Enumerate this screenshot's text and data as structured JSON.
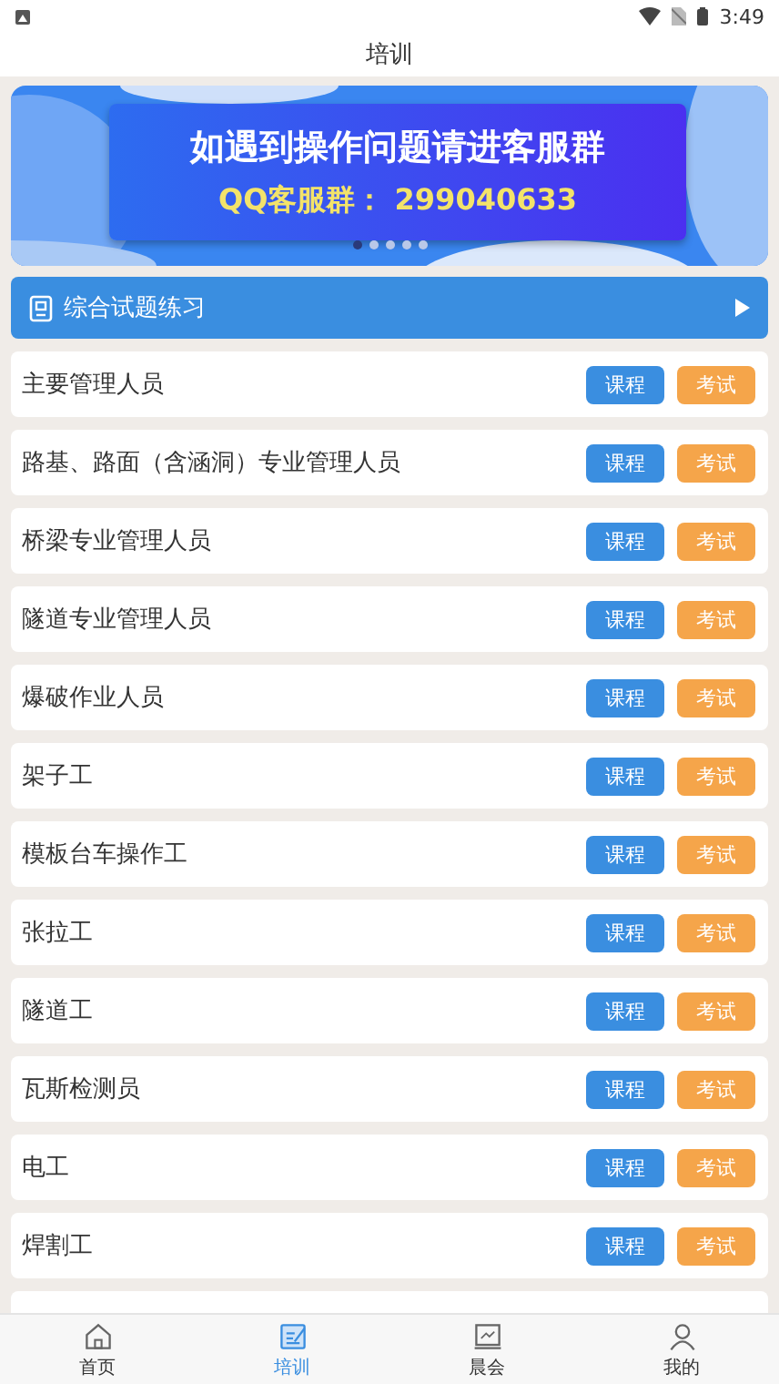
{
  "status_bar": {
    "time": "3:49"
  },
  "header": {
    "title": "培训"
  },
  "banner": {
    "headline": "如遇到操作问题请进客服群",
    "subline": "QQ客服群： 299040633",
    "dots": [
      {
        "selected": true
      },
      {
        "selected": false
      },
      {
        "selected": false
      },
      {
        "selected": false
      },
      {
        "selected": false
      }
    ]
  },
  "practice": {
    "label": "综合试题练习"
  },
  "rows": [
    {
      "label": "主要管理人员",
      "course": "课程",
      "exam": "考试"
    },
    {
      "label": "路基、路面（含涵洞）专业管理人员",
      "course": "课程",
      "exam": "考试"
    },
    {
      "label": "桥梁专业管理人员",
      "course": "课程",
      "exam": "考试"
    },
    {
      "label": "隧道专业管理人员",
      "course": "课程",
      "exam": "考试"
    },
    {
      "label": "爆破作业人员",
      "course": "课程",
      "exam": "考试"
    },
    {
      "label": "架子工",
      "course": "课程",
      "exam": "考试"
    },
    {
      "label": "模板台车操作工",
      "course": "课程",
      "exam": "考试"
    },
    {
      "label": "张拉工",
      "course": "课程",
      "exam": "考试"
    },
    {
      "label": "隧道工",
      "course": "课程",
      "exam": "考试"
    },
    {
      "label": "瓦斯检测员",
      "course": "课程",
      "exam": "考试"
    },
    {
      "label": "电工",
      "course": "课程",
      "exam": "考试"
    },
    {
      "label": "焊割工",
      "course": "课程",
      "exam": "考试"
    }
  ],
  "tabs": [
    {
      "label": "首页",
      "kind": "home",
      "selected": false
    },
    {
      "label": "培训",
      "kind": "training",
      "selected": true
    },
    {
      "label": "晨会",
      "kind": "meeting",
      "selected": false
    },
    {
      "label": "我的",
      "kind": "profile",
      "selected": false
    }
  ]
}
